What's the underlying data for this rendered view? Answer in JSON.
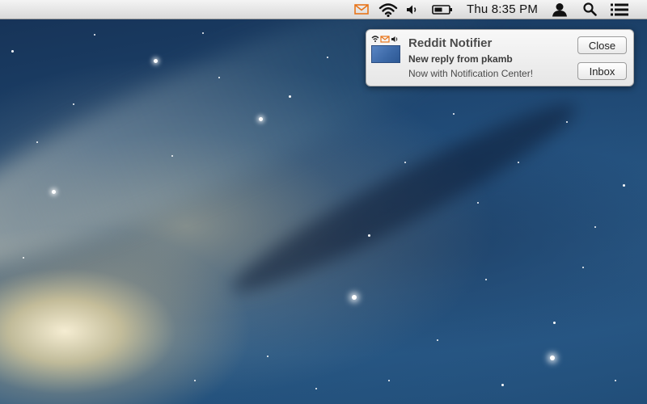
{
  "menu_bar": {
    "icons": [
      "mail-icon",
      "wifi-icon",
      "volume-icon",
      "battery-icon",
      "user-icon",
      "spotlight-search-icon",
      "notification-center-icon"
    ],
    "clock": "Thu 8:35 PM",
    "accent_color": "#e8751a"
  },
  "notification": {
    "app_name": "Reddit Notifier",
    "subtitle": "New reply from pkamb",
    "body": "Now with Notification Center!",
    "close_label": "Close",
    "inbox_label": "Inbox"
  },
  "desktop": {
    "wallpaper": "Mountain Lion galaxy"
  }
}
